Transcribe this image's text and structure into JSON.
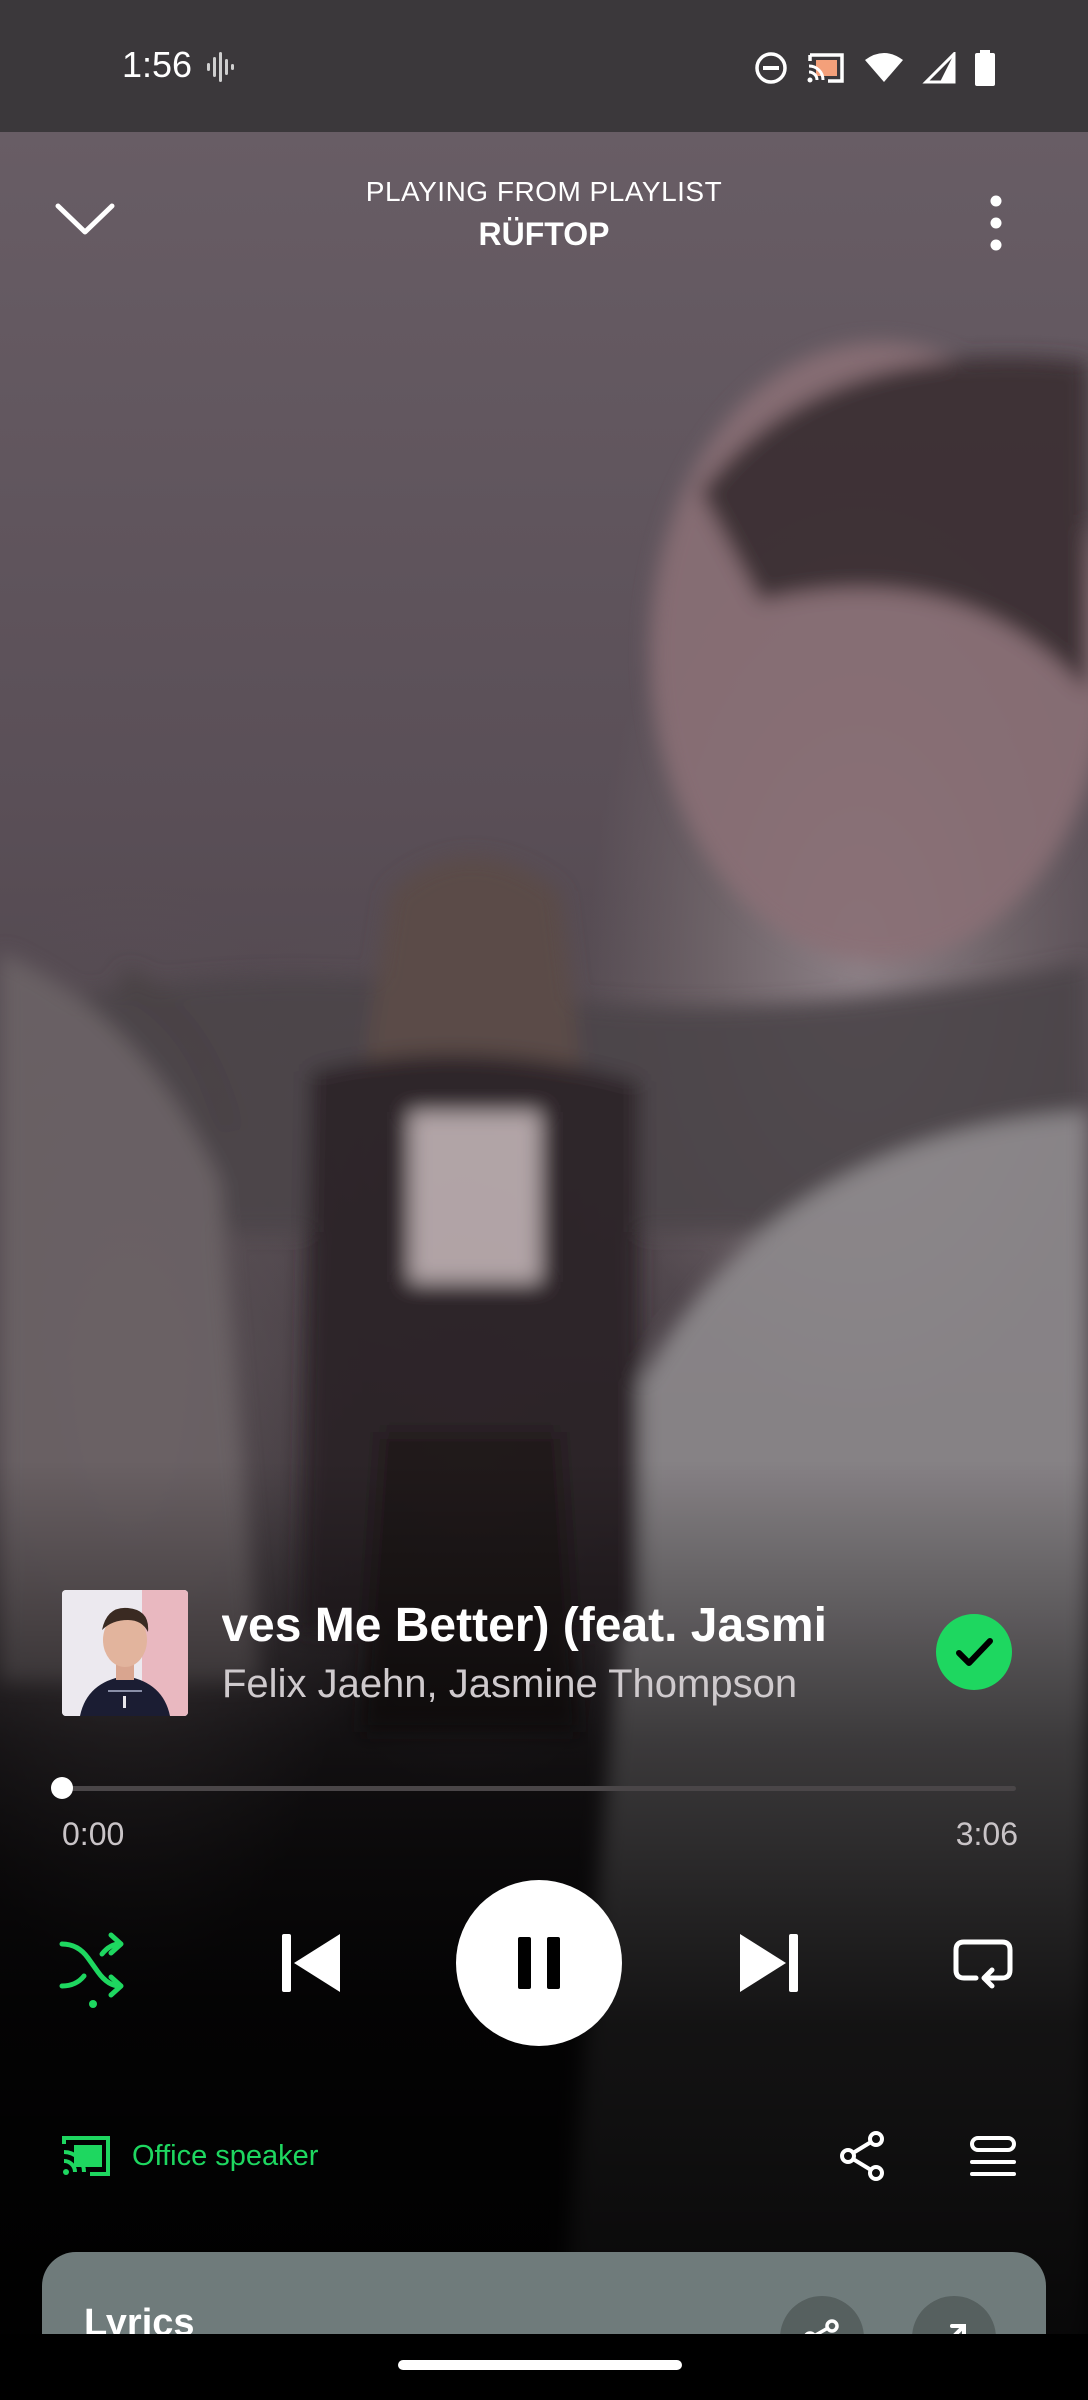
{
  "status_bar": {
    "time": "1:56",
    "icons": [
      "voice-recording-icon",
      "do-not-disturb-icon",
      "cast-icon",
      "wifi-icon",
      "cell-signal-icon",
      "battery-icon"
    ]
  },
  "header": {
    "context_label": "PLAYING FROM PLAYLIST",
    "playlist_name": "RÜFTOP"
  },
  "track": {
    "title": "oves Me Better) (feat. Jasmi",
    "artists": "Felix Jaehn, Jasmine Thompson",
    "liked": true
  },
  "progress": {
    "elapsed": "0:00",
    "total": "3:06",
    "fraction": 0.0
  },
  "controls": {
    "shuffle_on": true,
    "state": "playing"
  },
  "device": {
    "name": "Office speaker"
  },
  "lyrics": {
    "title": "Lyrics"
  },
  "colors": {
    "accent": "#1ed760",
    "status_bar": "#3b383b",
    "lyrics_card": "#6f7b7b"
  }
}
